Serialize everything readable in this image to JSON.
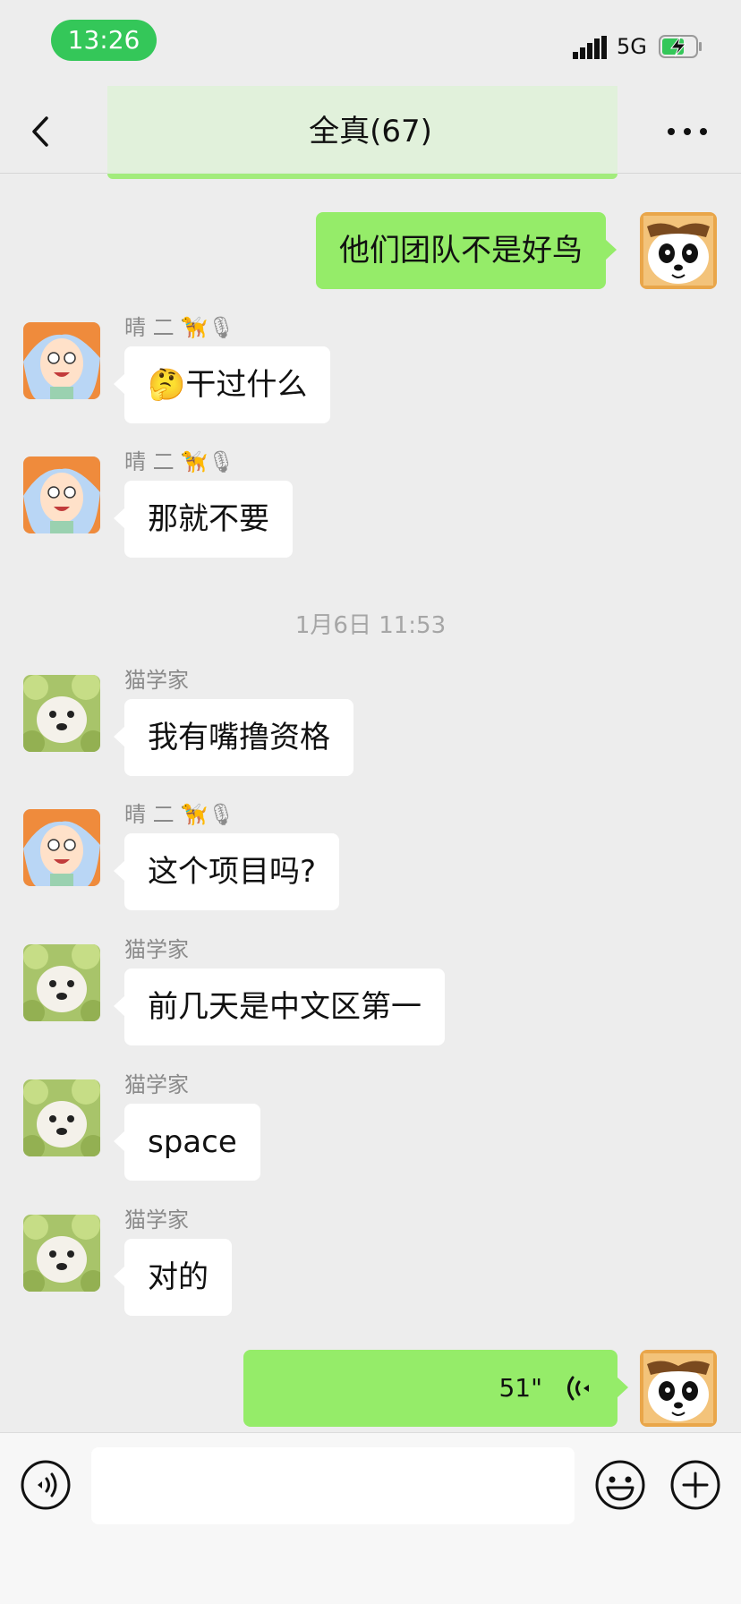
{
  "status_bar": {
    "time": "13:26",
    "network": "5G"
  },
  "header": {
    "title": "全真(67)"
  },
  "messages": [
    {
      "side": "out",
      "text": "他们团队不是好鸟"
    },
    {
      "side": "in",
      "sender": "晴 二",
      "sender_tag": "🦮🎙",
      "text": "🤔干过什么"
    },
    {
      "side": "in",
      "sender": "晴 二",
      "sender_tag": "🦮🎙",
      "text": "那就不要"
    },
    {
      "side": "in",
      "sender": "猫学家",
      "text": "我有嘴撸资格"
    },
    {
      "side": "in",
      "sender": "晴 二",
      "sender_tag": "🦮🎙",
      "text": "这个项目吗?"
    },
    {
      "side": "in",
      "sender": "猫学家",
      "text": "前几天是中文区第一"
    },
    {
      "side": "in",
      "sender": "猫学家",
      "text": "space"
    },
    {
      "side": "in",
      "sender": "猫学家",
      "text": "对的"
    },
    {
      "side": "out",
      "type": "voice",
      "duration": "51\""
    }
  ],
  "timestamp": "1月6日 11:53",
  "input": {
    "placeholder": ""
  },
  "icons": {
    "back": "chevron-left-icon",
    "more": "more-dots-icon",
    "voice_toggle": "voice-mode-icon",
    "emoji": "emoji-icon",
    "plus": "plus-icon"
  },
  "colors": {
    "bg": "#ededed",
    "out_bubble": "#95ec69",
    "in_bubble": "#ffffff",
    "status_pill": "#34c759"
  }
}
